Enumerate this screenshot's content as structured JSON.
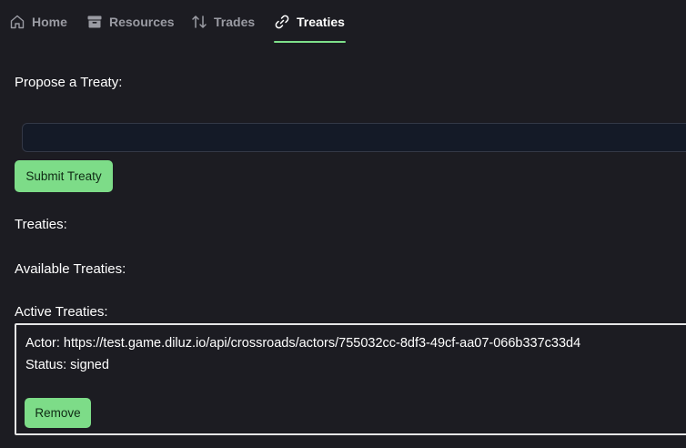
{
  "nav": {
    "tabs": [
      {
        "label": "Home",
        "icon": "home-icon",
        "active": false
      },
      {
        "label": "Resources",
        "icon": "archive-icon",
        "active": false
      },
      {
        "label": "Trades",
        "icon": "swap-arrows-icon",
        "active": false
      },
      {
        "label": "Treaties",
        "icon": "link-icon",
        "active": true
      }
    ]
  },
  "propose": {
    "heading": "Propose a Treaty:",
    "input_value": "",
    "input_placeholder": "",
    "submit_label": "Submit Treaty"
  },
  "sections": {
    "treaties_heading": "Treaties:",
    "available_heading": "Available Treaties:",
    "active_heading": "Active Treaties:"
  },
  "active_treaties": [
    {
      "actor_label": "Actor:",
      "actor_url": "https://test.game.diluz.io/api/crossroads/actors/755032cc-8df3-49cf-aa07-066b337c33d4",
      "status_label": "Status:",
      "status_value": "signed",
      "remove_label": "Remove"
    }
  ],
  "colors": {
    "background": "#1c1c22",
    "accent": "#7ddc88",
    "tab_inactive": "#9a9ba3",
    "input_bg": "#141a27"
  }
}
